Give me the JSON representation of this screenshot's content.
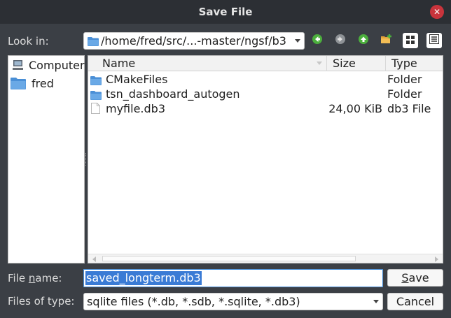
{
  "window": {
    "title": "Save File",
    "close_glyph": "✕"
  },
  "look_in": {
    "label": "Look in:",
    "path": "/home/fred/src/...-master/ngsf/b3"
  },
  "toolbar": {
    "icons": [
      "back-arrow-icon",
      "forward-arrow-icon",
      "parent-directory-icon",
      "new-folder-icon",
      "list-view-icon",
      "detail-view-icon"
    ]
  },
  "sidebar": {
    "items": [
      {
        "label": "Computer",
        "icon": "computer-icon"
      },
      {
        "label": "fred",
        "icon": "folder-icon"
      }
    ]
  },
  "file_list": {
    "columns": {
      "name": "Name",
      "size": "Size",
      "type": "Type"
    },
    "rows": [
      {
        "name": "CMakeFiles",
        "size": "",
        "type": "Folder",
        "icon": "folder-icon"
      },
      {
        "name": "tsn_dashboard_autogen",
        "size": "",
        "type": "Folder",
        "icon": "folder-icon"
      },
      {
        "name": "myfile.db3",
        "size": "24,00 KiB",
        "type": "db3 File",
        "icon": "file-icon"
      }
    ]
  },
  "file_name": {
    "label_pre": "File ",
    "label_mnemonic": "n",
    "label_post": "ame:",
    "value": "saved_longterm.db3"
  },
  "file_type": {
    "label": "Files of type:",
    "value": "sqlite files (*.db, *.sdb, *.sqlite, *.db3)"
  },
  "buttons": {
    "save_mnemonic": "S",
    "save_rest": "ave",
    "cancel": "Cancel"
  },
  "colors": {
    "titlebar": "#2c2f34",
    "dialog_bg": "#3b3f45",
    "selection": "#3a7bd5",
    "folder": "#4a8fd6",
    "close": "#c9343c"
  }
}
